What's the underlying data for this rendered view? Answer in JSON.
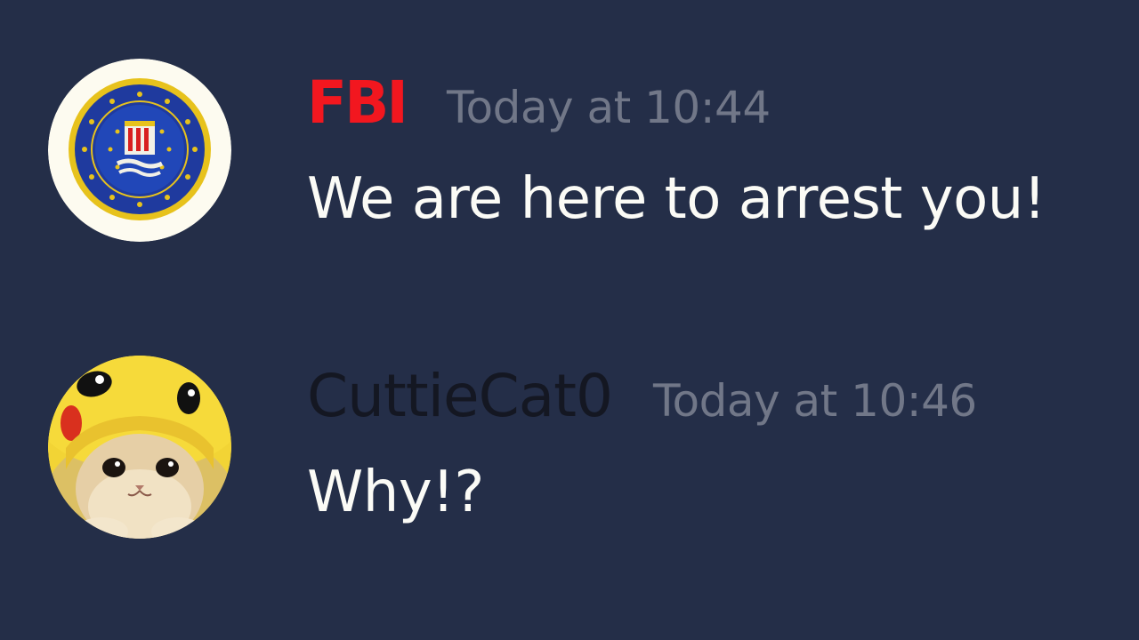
{
  "messages": [
    {
      "author": "FBI",
      "author_color": "#f2171f",
      "timestamp": "Today at 10:44",
      "text": "We are here to arrest you!",
      "avatar": "fbi-seal-avatar"
    },
    {
      "author": "CuttieCat0",
      "author_color": "#141722",
      "timestamp": "Today at 10:46",
      "text": "Why!?",
      "avatar": "cat-in-pikachu-hood-avatar"
    }
  ],
  "colors": {
    "background": "#242e48",
    "timestamp": "#717788",
    "message_text": "#fbfbf6"
  }
}
